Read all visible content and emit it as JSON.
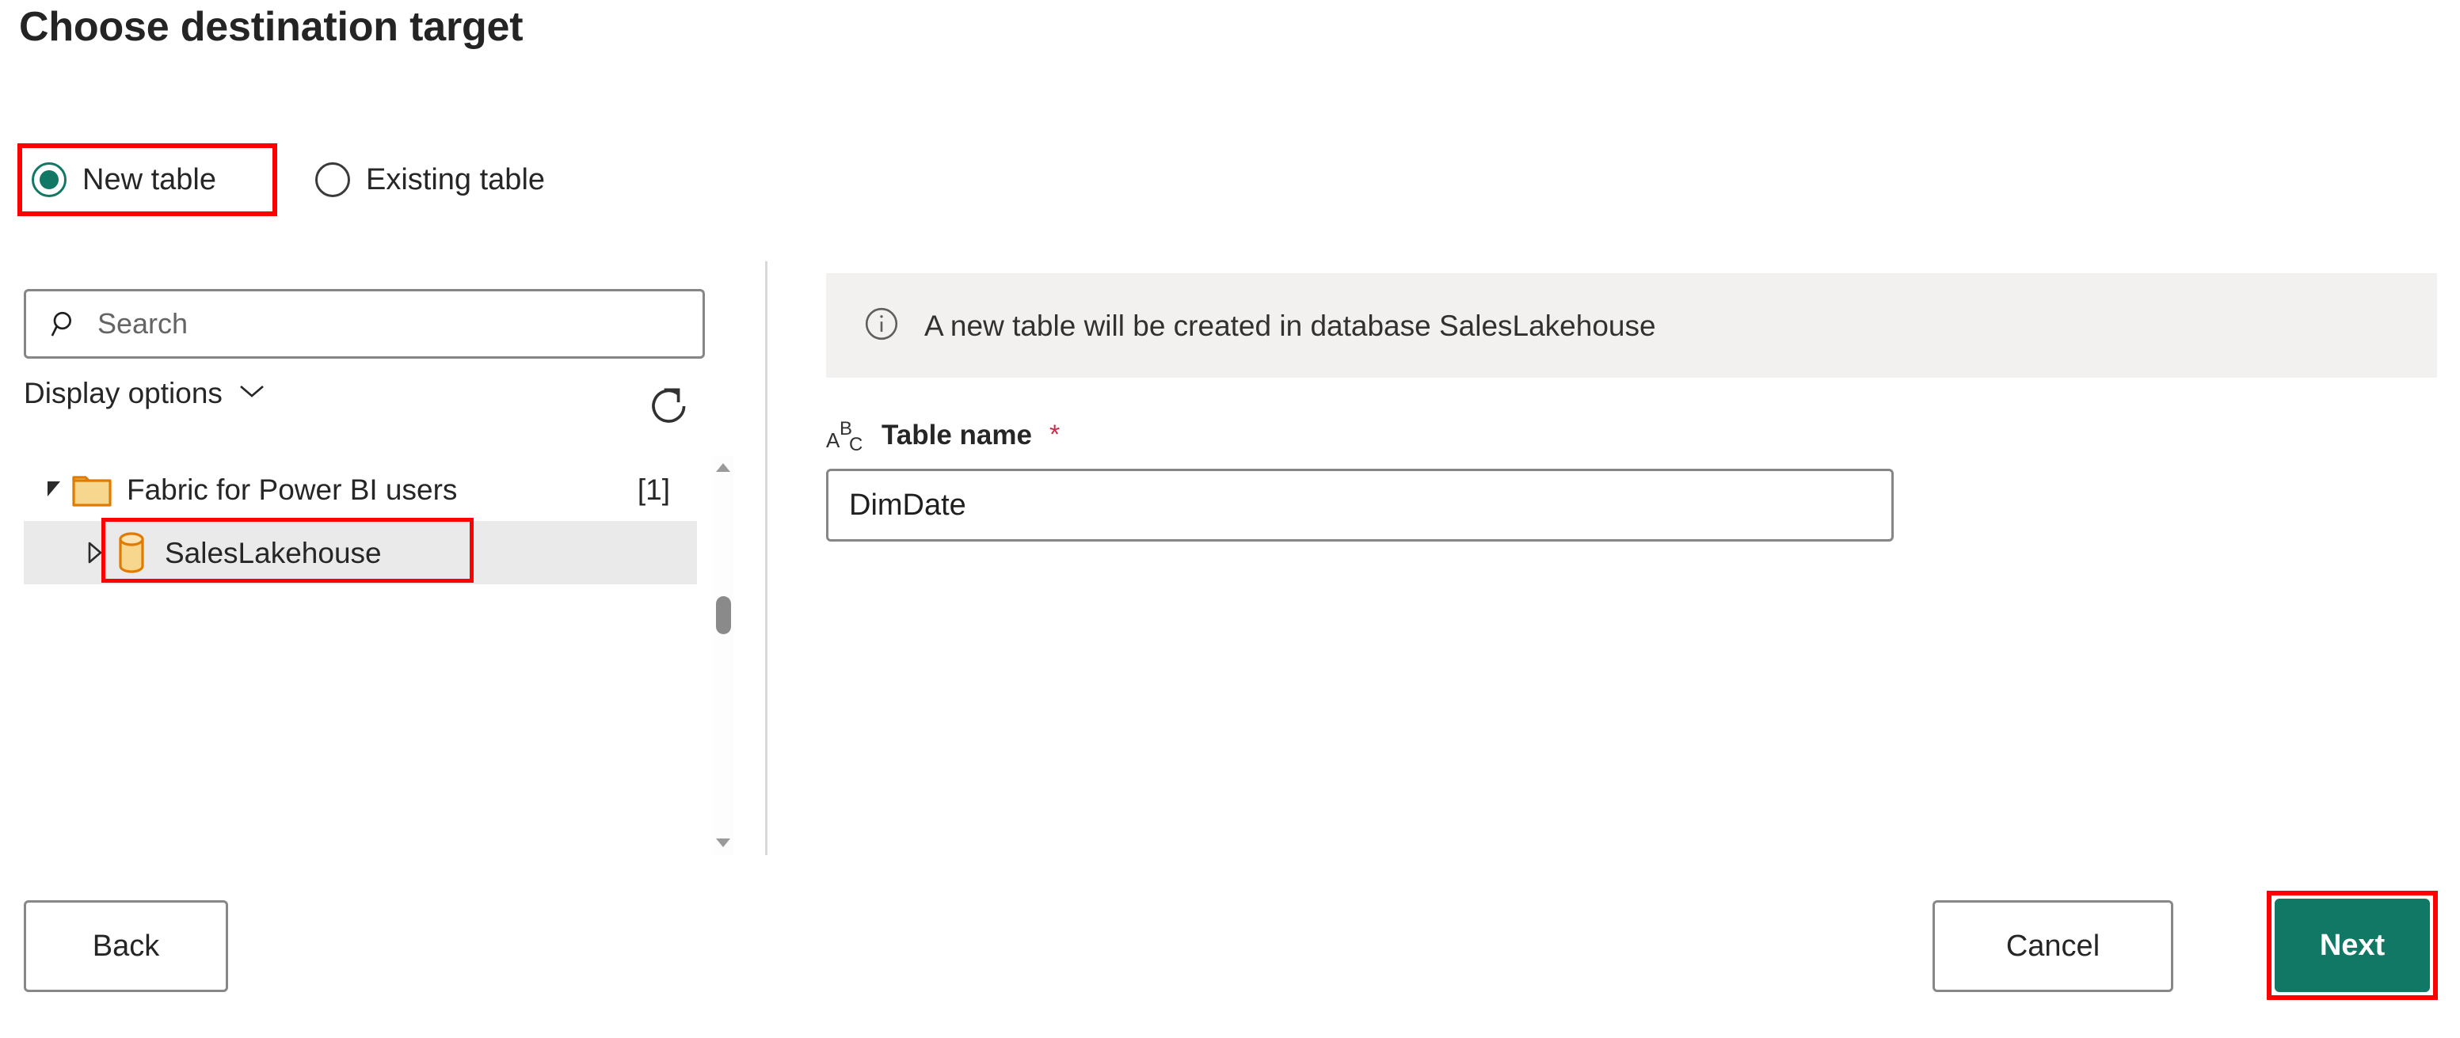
{
  "page": {
    "title": "Choose destination target"
  },
  "target_mode": {
    "options": [
      {
        "label": "New table",
        "selected": true
      },
      {
        "label": "Existing table",
        "selected": false
      }
    ]
  },
  "left_panel": {
    "search": {
      "placeholder": "Search",
      "value": "",
      "icon": "search-icon"
    },
    "display_options": {
      "label": "Display options",
      "chevron_icon": "chevron-down-icon"
    },
    "refresh": {
      "icon": "refresh-icon",
      "tooltip": "Refresh"
    },
    "tree": [
      {
        "label": "Fabric for Power BI users",
        "count": "[1]",
        "icon": "folder-icon",
        "expanded": true,
        "selected": false
      },
      {
        "label": "SalesLakehouse",
        "count": "",
        "icon": "database-icon",
        "expanded": false,
        "selected": true
      }
    ],
    "scrollbar": {
      "up_icon": "scroll-up-arrow-icon",
      "down_icon": "scroll-down-arrow-icon"
    }
  },
  "right_panel": {
    "info": {
      "icon": "info-icon",
      "message": "A new table will be created in database SalesLakehouse"
    },
    "table_name": {
      "type_icon": "abc-text-type-icon",
      "label": "Table name",
      "required_marker": "*",
      "value": "DimDate",
      "placeholder": "Table name"
    }
  },
  "footer": {
    "back_label": "Back",
    "cancel_label": "Cancel",
    "next_label": "Next"
  },
  "colors": {
    "accent_teal": "#117865",
    "highlight_red": "#ff0000",
    "info_bar_bg": "#f2f1f0",
    "selected_row_bg": "#eaeaea",
    "folder_fill": "#f5cf87",
    "folder_stroke": "#e07b00",
    "required_red": "#c4314b"
  }
}
